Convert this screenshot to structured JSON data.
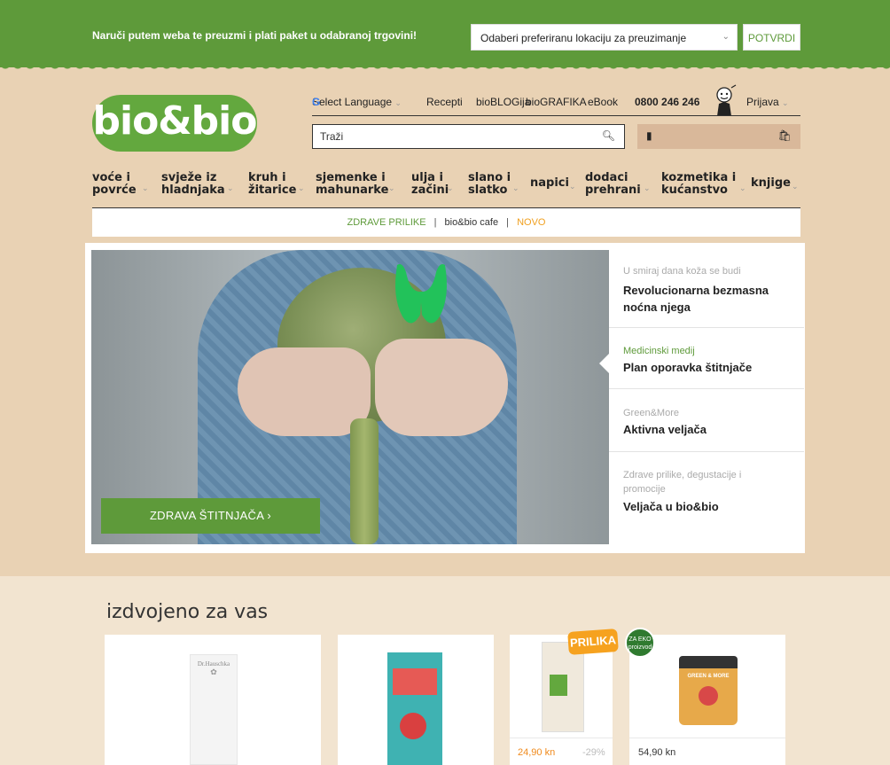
{
  "topbar": {
    "message": "Naruči putem weba te preuzmi i plati paket u odabranoj trgovini!",
    "location_select": "Odaberi preferiranu lokaciju za preuzimanje",
    "confirm_label": "POTVRDI"
  },
  "logo": {
    "text": "bio&bio"
  },
  "util_nav": {
    "language": "Select Language",
    "links": [
      "Recepti",
      "bioBLOGija",
      "bioGRAFIKA",
      "eBook"
    ],
    "phone": "0800 246 246",
    "login": "Prijava"
  },
  "search": {
    "placeholder": "Traži"
  },
  "categories": [
    {
      "line1": "voće i",
      "line2": "povrće"
    },
    {
      "line1": "svježe iz",
      "line2": "hladnjaka"
    },
    {
      "line1": "kruh i",
      "line2": "žitarice"
    },
    {
      "line1": "sjemenke i",
      "line2": "mahunarke"
    },
    {
      "line1": "ulja i",
      "line2": "začini"
    },
    {
      "line1": "slano i",
      "line2": "slatko"
    },
    {
      "line1": "napici",
      "line2": ""
    },
    {
      "line1": "dodaci",
      "line2": "prehrani"
    },
    {
      "line1": "kozmetika i",
      "line2": "kućanstvo"
    },
    {
      "line1": "knjige",
      "line2": ""
    }
  ],
  "subnav": {
    "item1": "ZDRAVE PRILIKE",
    "item2": "bio&bio cafe",
    "item3": "NOVO",
    "separator": "|"
  },
  "hero": {
    "cta_label": "ZDRAVA ŠTITNJAČA ›"
  },
  "side_items": [
    {
      "kicker": "U smiraj dana koža se budi",
      "title": "Revolucionarna bezmasna noćna njega"
    },
    {
      "kicker": "Medicinski medij",
      "title": "Plan oporavka štitnjače"
    },
    {
      "kicker": "Green&More",
      "title": "Aktivna veljača"
    },
    {
      "kicker": "Zdrave prilike, degustacije i promocije",
      "title": "Veljača u bio&bio"
    }
  ],
  "featured": {
    "title": "izdvojeno za vas",
    "badge_prilika": "PRILIKA",
    "badge_eco": "ZA EKO proizvod",
    "products": [
      {
        "brand": "Dr.Hauschka",
        "price": "",
        "discount": ""
      },
      {
        "brand": "",
        "price": "",
        "discount": ""
      },
      {
        "brand": "",
        "price": "24,90 kn",
        "discount": "-29%"
      },
      {
        "brand": "GREEN & MORE",
        "price": "54,90 kn",
        "discount": ""
      }
    ]
  },
  "colors": {
    "brand_green": "#5e9a3a",
    "accent_orange": "#f08a1c",
    "kraft": "#e9d2b4"
  }
}
